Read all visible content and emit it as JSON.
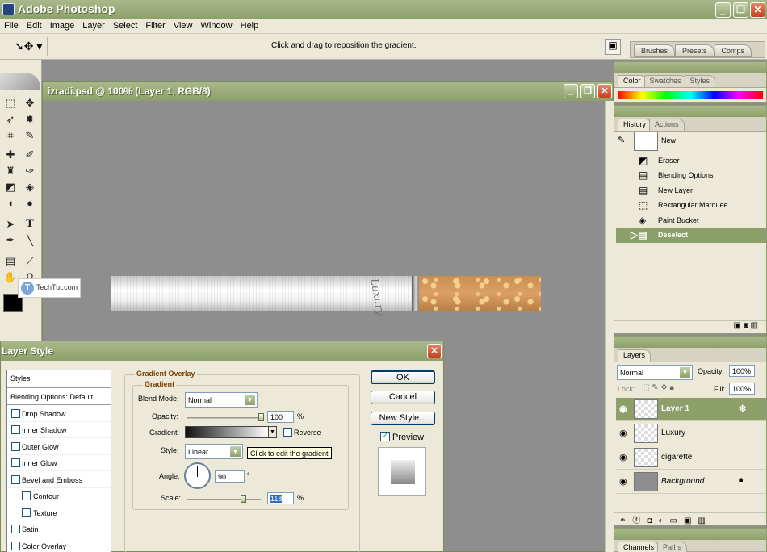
{
  "app": {
    "title": "Adobe Photoshop",
    "window_buttons": {
      "minimize": "_",
      "restore": "❐",
      "close": "✕"
    }
  },
  "menu": [
    "File",
    "Edit",
    "Image",
    "Layer",
    "Select",
    "Filter",
    "View",
    "Window",
    "Help"
  ],
  "options_bar": {
    "hint": "Click and drag to reposition the gradient.",
    "palette_tabs": [
      "Brushes",
      "Presets",
      "Comps"
    ]
  },
  "document": {
    "title": "izradi.psd @ 100% (Layer 1, RGB/8)",
    "logo_text": "Luxury",
    "watermark": "TechTut.com"
  },
  "color_panel": {
    "tabs": [
      "Color",
      "Swatches",
      "Styles"
    ]
  },
  "history_panel": {
    "tabs": [
      "History",
      "Actions"
    ],
    "snapshot": "New",
    "items": [
      "Eraser",
      "Blending Options",
      "New Layer",
      "Rectangular Marquee",
      "Paint Bucket",
      "Deselect"
    ],
    "selected": "Deselect"
  },
  "layers_panel": {
    "tab": "Layers",
    "blend_mode": "Normal",
    "opacity_label": "Opacity:",
    "opacity": "100%",
    "lock_label": "Lock:",
    "fill_label": "Fill:",
    "fill": "100%",
    "layers": [
      "Layer 1",
      "Luxury",
      "cigarette",
      "Background"
    ],
    "selected": "Layer 1"
  },
  "channels_panel": {
    "tabs": [
      "Channels",
      "Paths"
    ]
  },
  "layer_style": {
    "title": "Layer Style",
    "styles_header": "Styles",
    "blending_options": "Blending Options: Default",
    "effects": [
      "Drop Shadow",
      "Inner Shadow",
      "Outer Glow",
      "Inner Glow",
      "Bevel and Emboss",
      "Contour",
      "Texture",
      "Satin",
      "Color Overlay"
    ],
    "section_title": "Gradient Overlay",
    "section_sub": "Gradient",
    "blend_mode_label": "Blend Mode:",
    "blend_mode": "Normal",
    "opacity_label": "Opacity:",
    "opacity": "100",
    "pct": "%",
    "gradient_label": "Gradient:",
    "reverse_label": "Reverse",
    "style_label": "Style:",
    "style": "Linear",
    "tooltip": "Click to edit the gradient",
    "angle_label": "Angle:",
    "angle": "90",
    "degree": "°",
    "scale_label": "Scale:",
    "scale": "118",
    "buttons": {
      "ok": "OK",
      "cancel": "Cancel",
      "new_style": "New Style...",
      "preview": "Preview"
    }
  },
  "colors": {
    "accent": "#a9b98a",
    "selected_row": "#8ea06a",
    "panel": "#ece9d8",
    "canvas": "#8e8e8e"
  }
}
